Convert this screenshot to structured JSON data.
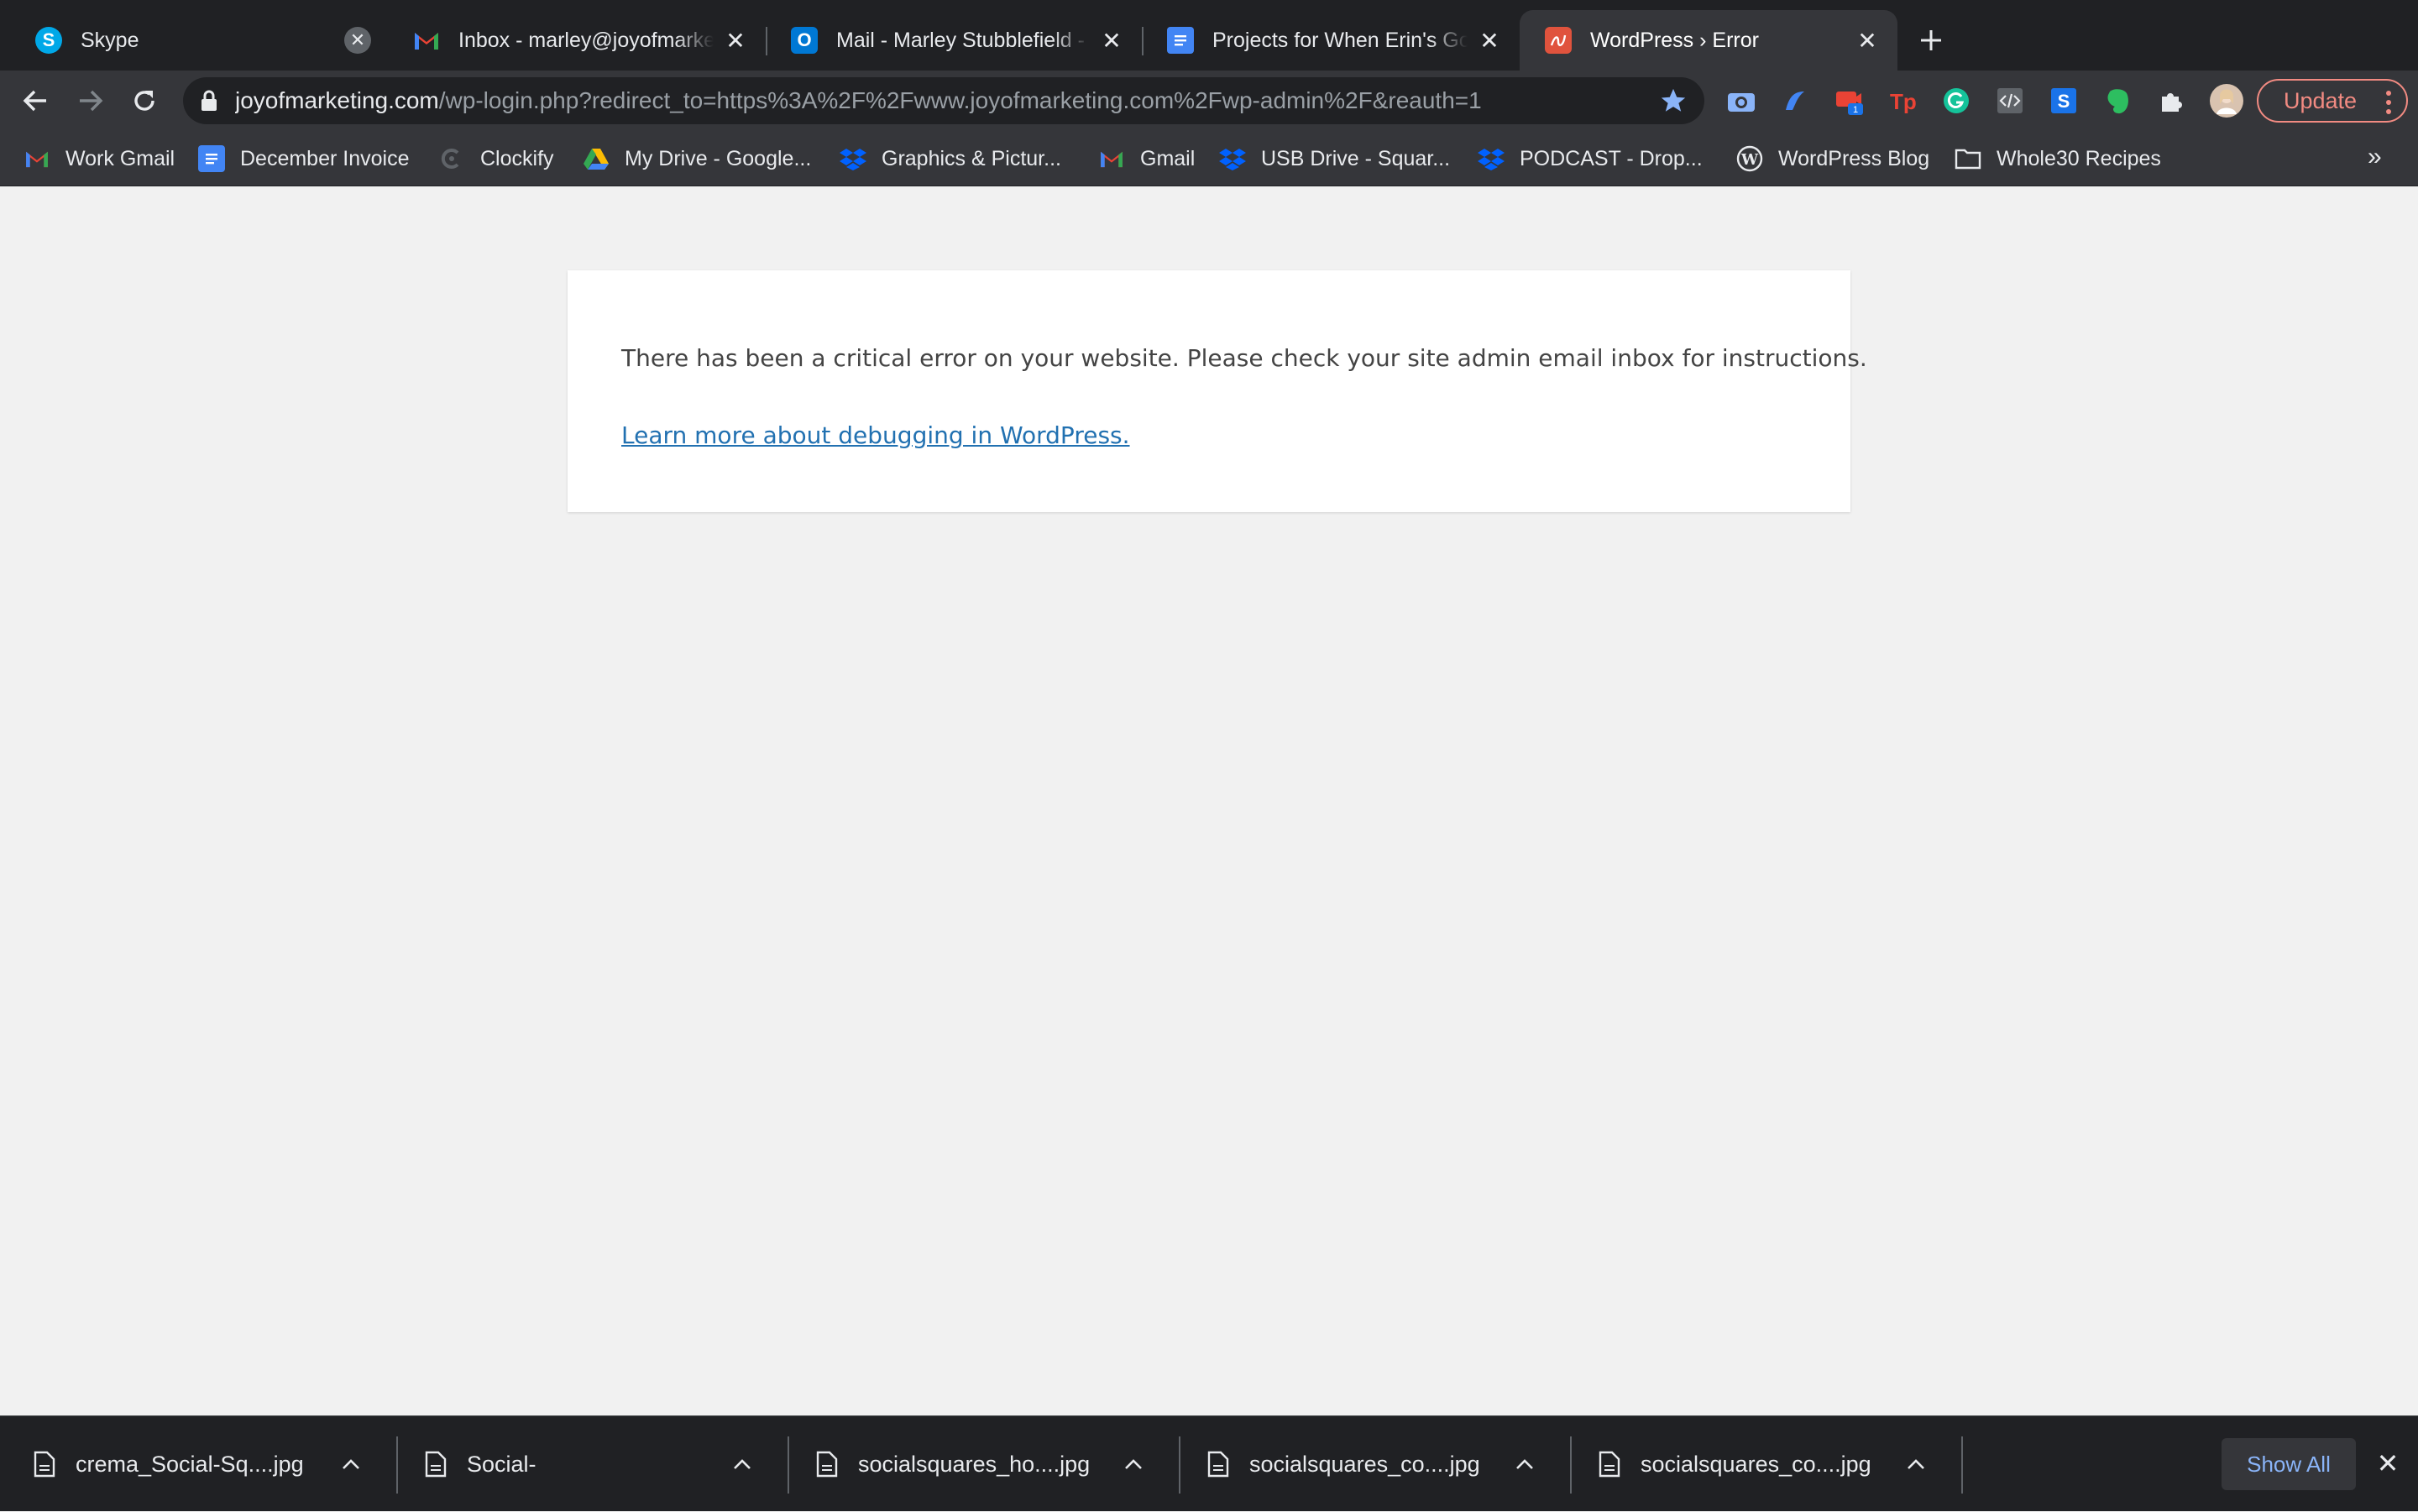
{
  "tabs": [
    {
      "title": "Skype",
      "icon": "skype-icon",
      "active": false
    },
    {
      "title": "Inbox - marley@joyofmarketing.com",
      "icon": "gmail-icon",
      "active": false
    },
    {
      "title": "Mail - Marley Stubblefield - Outlook",
      "icon": "outlook-icon",
      "active": false
    },
    {
      "title": "Projects for When Erin's Gone",
      "icon": "google-docs-icon",
      "active": false
    },
    {
      "title": "WordPress › Error",
      "icon": "wordpress-error-icon",
      "active": true
    }
  ],
  "address_bar": {
    "host": "joyofmarketing.com",
    "path": "/wp-login.php?redirect_to=https%3A%2F%2Fwww.joyofmarketing.com%2Fwp-admin%2F&reauth=1"
  },
  "extensions": {
    "badge_count": "1",
    "update_label": "Update"
  },
  "bookmarks": [
    {
      "label": "Work Gmail",
      "icon": "gmail-icon"
    },
    {
      "label": "December Invoice",
      "icon": "google-docs-icon"
    },
    {
      "label": "Clockify",
      "icon": "clockify-icon"
    },
    {
      "label": "My Drive - Google...",
      "icon": "google-drive-icon"
    },
    {
      "label": "Graphics & Pictur...",
      "icon": "dropbox-icon"
    },
    {
      "label": "Gmail",
      "icon": "gmail-icon"
    },
    {
      "label": "USB Drive - Squar...",
      "icon": "dropbox-icon"
    },
    {
      "label": "PODCAST - Drop...",
      "icon": "dropbox-icon"
    },
    {
      "label": "WordPress Blog",
      "icon": "wordpress-icon"
    },
    {
      "label": "Whole30 Recipes",
      "icon": "folder-icon"
    }
  ],
  "page": {
    "message": "There has been a critical error on your website. Please check your site admin email inbox for instructions.",
    "link_text": "Learn more about debugging in WordPress."
  },
  "downloads": [
    {
      "name": "crema_Social-Sq....jpg"
    },
    {
      "name": "Social-"
    },
    {
      "name": "socialsquares_ho....jpg"
    },
    {
      "name": "socialsquares_co....jpg"
    },
    {
      "name": "socialsquares_co....jpg"
    }
  ],
  "download_shelf": {
    "show_all_label": "Show All"
  },
  "colors": {
    "link": "#2271b1",
    "update_accent": "#f28b82",
    "show_all": "#8ab4f8"
  }
}
